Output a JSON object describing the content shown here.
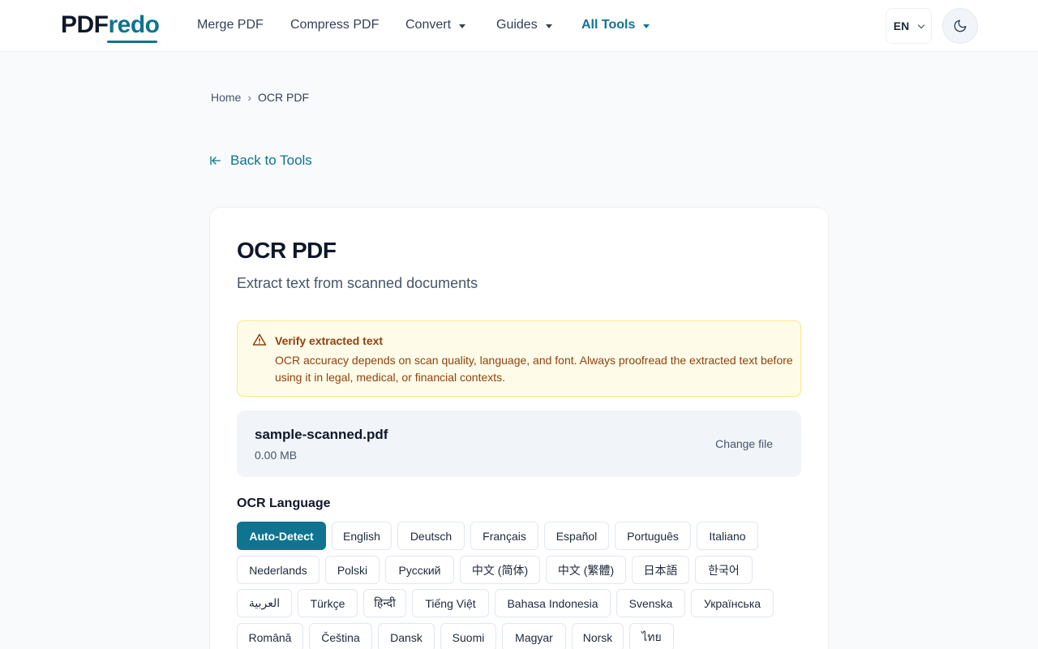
{
  "header": {
    "logo_part1": "PDF",
    "logo_part2": "redo",
    "nav": [
      {
        "label": "Merge PDF"
      },
      {
        "label": "Compress PDF"
      },
      {
        "label": "Convert"
      },
      {
        "label": "Guides"
      },
      {
        "label": "All Tools"
      }
    ],
    "language": "EN"
  },
  "breadcrumb": {
    "home": "Home",
    "separator": "›",
    "current": "OCR PDF"
  },
  "back_link": "Back to Tools",
  "tool": {
    "title": "OCR PDF",
    "subtitle": "Extract text from scanned documents"
  },
  "warning": {
    "title": "Verify extracted text",
    "text": "OCR accuracy depends on scan quality, language, and font. Always proofread the extracted text before using it in legal, medical, or financial contexts."
  },
  "file": {
    "name": "sample-scanned.pdf",
    "size": "0.00 MB",
    "change_label": "Change file"
  },
  "ocr_language": {
    "label": "OCR Language",
    "selected": "Auto-Detect",
    "options": [
      "Auto-Detect",
      "English",
      "Deutsch",
      "Français",
      "Español",
      "Português",
      "Italiano",
      "Nederlands",
      "Polski",
      "Русский",
      "中文 (简体)",
      "中文 (繁體)",
      "日本語",
      "한국어",
      "العربية",
      "Türkçe",
      "हिन्दी",
      "Tiếng Việt",
      "Bahasa Indonesia",
      "Svenska",
      "Українська",
      "Română",
      "Čeština",
      "Dansk",
      "Suomi",
      "Magyar",
      "Norsk",
      "ไทย"
    ]
  },
  "colors": {
    "brand": "#0e7490",
    "warning_bg": "#fefce8",
    "warning_text": "#92400e"
  }
}
